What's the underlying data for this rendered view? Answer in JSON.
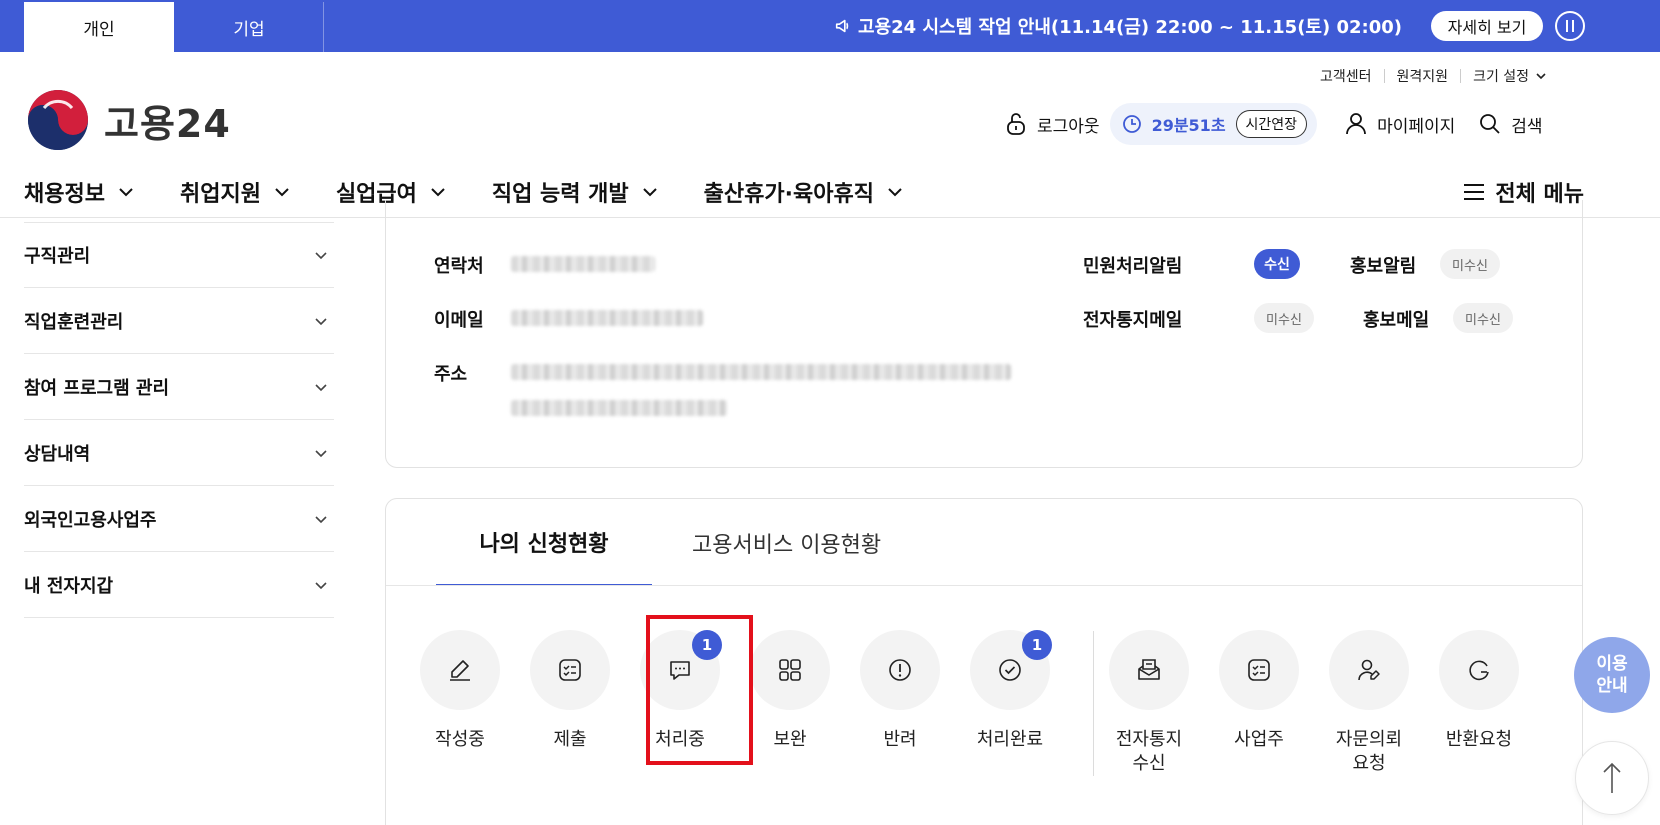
{
  "topbar": {
    "tab_personal": "개인",
    "tab_corporate": "기업",
    "notice": "고용24 시스템 작업 안내(11.14(금) 22:00 ~ 11.15(토) 02:00)",
    "detail_button": "자세히 보기"
  },
  "util_links": [
    "고객센터",
    "원격지원",
    "크기 설정"
  ],
  "logo": {
    "name": "고용24"
  },
  "user_bar": {
    "logout": "로그아웃",
    "timer": "29분51초",
    "extend": "시간연장",
    "mypage": "마이페이지",
    "search": "검색"
  },
  "gnb": {
    "menus": [
      "채용정보",
      "취업지원",
      "실업급여",
      "직업 능력 개발",
      "출산휴가·육아휴직"
    ],
    "all_menu": "전체 메뉴"
  },
  "sidebar": {
    "items": [
      "구직관리",
      "직업훈련관리",
      "참여 프로그램 관리",
      "상담내역",
      "외국인고용사업주",
      "내 전자지갑"
    ]
  },
  "profile": {
    "contact_label": "연락처",
    "email_label": "이메일",
    "address_label": "주소",
    "civil_alert_label": "민원처리알림",
    "civil_alert_value": "수신",
    "promo_alert_label": "홍보알림",
    "promo_alert_value": "미수신",
    "e_notice_mail_label": "전자통지메일",
    "e_notice_mail_value": "미수신",
    "promo_mail_label": "홍보메일",
    "promo_mail_value": "미수신"
  },
  "status": {
    "tabs": [
      "나의 신청현황",
      "고용서비스 이용현황"
    ],
    "items": [
      {
        "label": "작성중",
        "icon": "pencil-icon",
        "count": null
      },
      {
        "label": "제출",
        "icon": "checklist-icon",
        "count": null
      },
      {
        "label": "처리중",
        "icon": "chat-bubble-icon",
        "count": "1"
      },
      {
        "label": "보완",
        "icon": "grid-icon",
        "count": null
      },
      {
        "label": "반려",
        "icon": "exclamation-circle-icon",
        "count": null
      },
      {
        "label": "처리완료",
        "icon": "check-circle-icon",
        "count": "1"
      },
      {
        "label": "전자통지\n수신",
        "icon": "inbox-icon",
        "count": null
      },
      {
        "label": "사업주",
        "icon": "checklist-icon",
        "count": null
      },
      {
        "label": "자문의뢰\n요청",
        "icon": "user-edit-icon",
        "count": null
      },
      {
        "label": "반환요청",
        "icon": "refresh-icon",
        "count": null
      }
    ]
  },
  "float": {
    "guide": "이용\n안내"
  },
  "colors": {
    "primary": "#3f5bd5",
    "highlight": "#e3101b",
    "guide": "#8fa7ea"
  }
}
